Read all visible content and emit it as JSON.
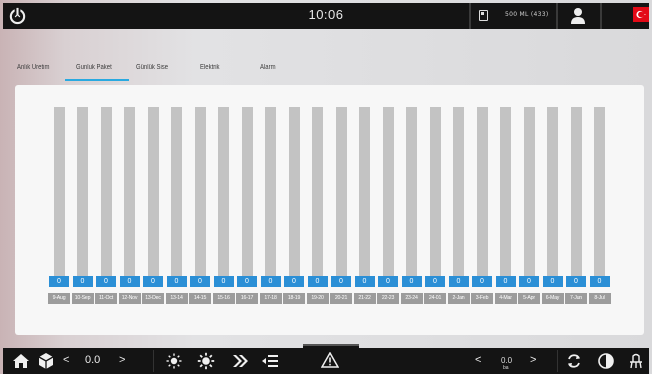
{
  "topbar": {
    "time": "10:06",
    "status_text": "500 ML (433)"
  },
  "tabs": [
    {
      "label": "Anlık Uretim",
      "active": false
    },
    {
      "label": "Gunluk Paket",
      "active": true
    },
    {
      "label": "Günlük Sise",
      "active": false
    },
    {
      "label": "Elektrik",
      "active": false
    },
    {
      "label": "Alarm",
      "active": false
    }
  ],
  "accent_color": "#29a9e0",
  "value_color": "#2b8fd6",
  "chart_data": {
    "type": "bar",
    "categories": [
      "9-Aug",
      "10-Sep",
      "11-Oct",
      "12-Nov",
      "13-Dec",
      "13-14",
      "14-15",
      "15-16",
      "16-17",
      "17-18",
      "18-19",
      "19-20",
      "20-21",
      "21-22",
      "22-23",
      "23-24",
      "24-01",
      "2-Jan",
      "3-Feb",
      "4-Mar",
      "5-Apr",
      "6-May",
      "7-Jun",
      "8-Jul"
    ],
    "values": [
      0,
      0,
      0,
      0,
      0,
      0,
      0,
      0,
      0,
      0,
      0,
      0,
      0,
      0,
      0,
      0,
      0,
      0,
      0,
      0,
      0,
      0,
      0,
      0
    ],
    "value_labels": [
      "0",
      "0",
      "0",
      "0",
      "0",
      "0",
      "0",
      "0",
      "0",
      "0",
      "0",
      "0",
      "0",
      "0",
      "0",
      "0",
      "0",
      "0",
      "0",
      "0",
      "0",
      "0",
      "0",
      "0"
    ]
  },
  "bottombar": {
    "speed_left": "0.0",
    "speed_right": "0.0",
    "speed_right_unit": "ba"
  }
}
